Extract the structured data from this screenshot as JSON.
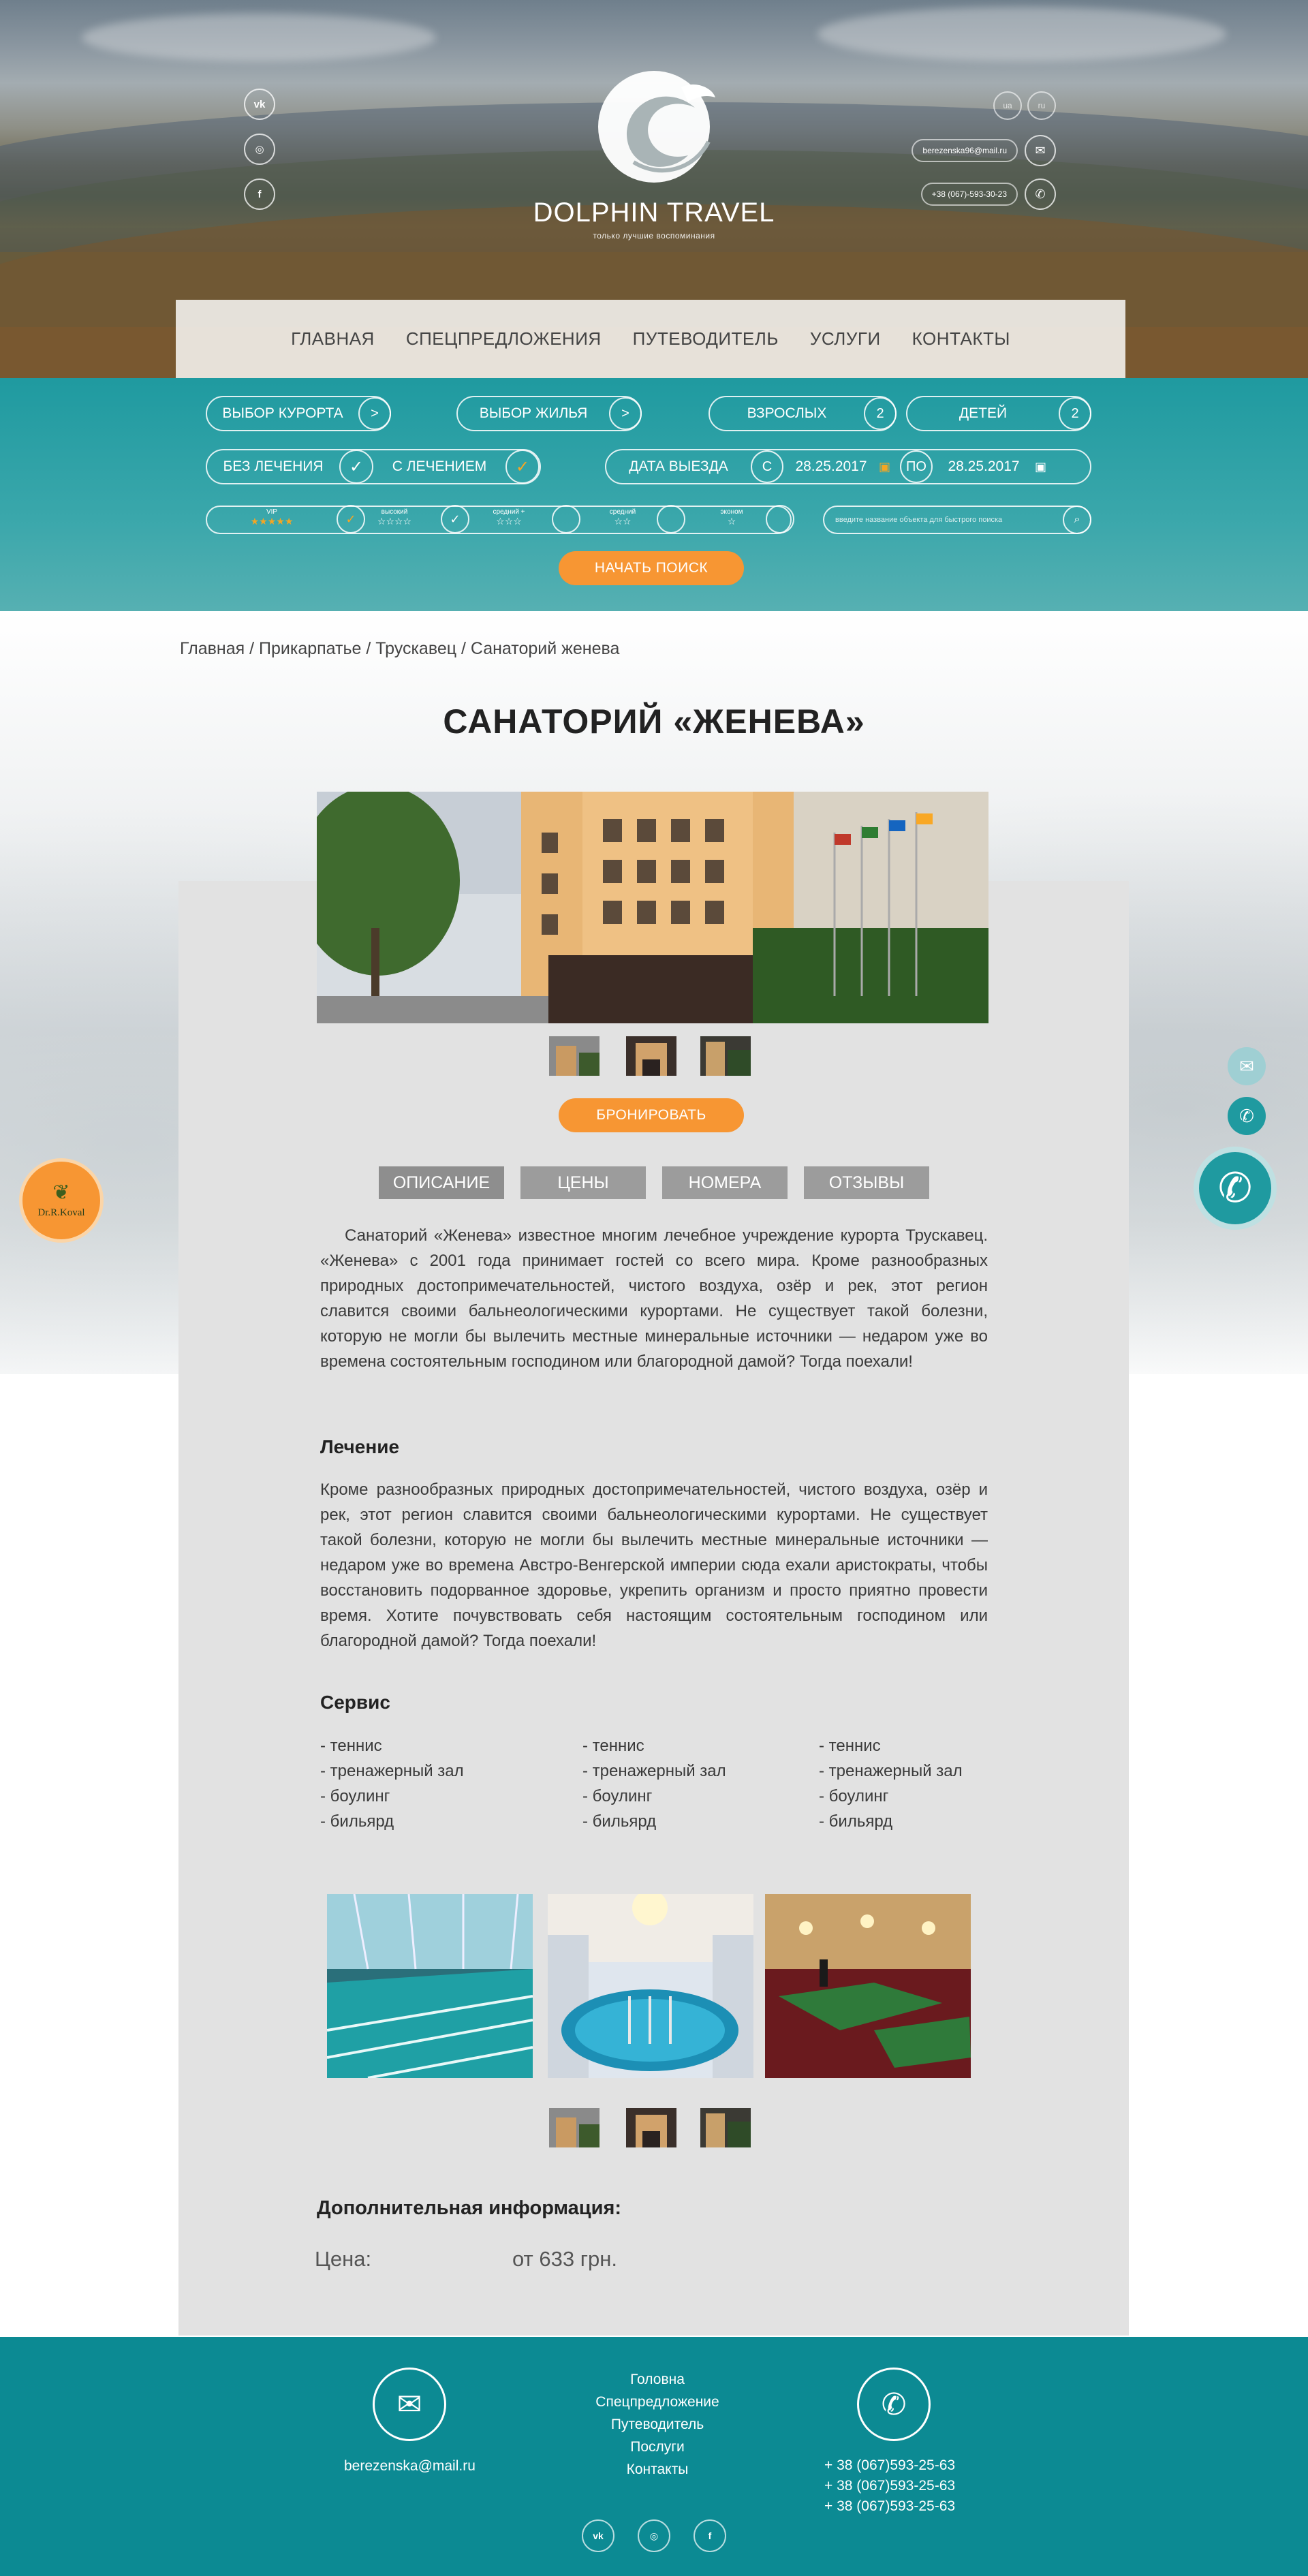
{
  "colors": {
    "teal": "#1f9aa0",
    "footer_teal": "#0c8a93",
    "orange": "#f79633",
    "card_gray": "#e2e2e2",
    "tab_gray": "#9c9c9c"
  },
  "header": {
    "social": [
      {
        "icon": "vk-icon",
        "glyph": "vk"
      },
      {
        "icon": "instagram-icon",
        "glyph": "◎"
      },
      {
        "icon": "facebook-icon",
        "glyph": "f"
      }
    ],
    "logo_name": "DOLPHIN TRAVEL",
    "logo_tagline": "только лучшие воспоминания",
    "lang": [
      "ua",
      "ru"
    ],
    "email": "berezenska96@mail.ru",
    "phone": "+38 (067)-593-30-23"
  },
  "nav": [
    "ГЛАВНАЯ",
    "СПЕЦПРЕДЛОЖЕНИЯ",
    "ПУТЕВОДИТЕЛЬ",
    "УСЛУГИ",
    "КОНТАКТЫ"
  ],
  "search": {
    "resort_label": "ВЫБОР КУРОРТА",
    "housing_label": "ВЫБОР ЖИЛЬЯ",
    "adults_label": "ВЗРОСЛЫХ",
    "adults_value": "2",
    "children_label": "ДЕТЕЙ",
    "children_value": "2",
    "no_treatment": "БЕЗ ЛЕЧЕНИЯ",
    "with_treatment": "С ЛЕЧЕНИЕМ",
    "departure_label": "ДАТА ВЫЕЗДА",
    "from_label": "С",
    "from_date": "28.25.2017",
    "to_label": "ПО",
    "to_date": "28.25.2017",
    "classes": [
      {
        "label": "VIP",
        "stars": "★★★★★",
        "gold": true
      },
      {
        "label": "высокий",
        "stars": "☆☆☆☆",
        "gold": false
      },
      {
        "label": "средний +",
        "stars": "☆☆☆",
        "gold": false
      },
      {
        "label": "средний",
        "stars": "☆☆",
        "gold": false
      },
      {
        "label": "эконом",
        "stars": "☆",
        "gold": false
      }
    ],
    "quick_placeholder": "введите название объекта для быстрого поиска",
    "submit": "НАЧАТЬ ПОИСК"
  },
  "breadcrumb": "Главная / Прикарпатье / Трускавец / Санаторий женева",
  "title": "САНАТОРИЙ «ЖЕНЕВА»",
  "book_button": "БРОНИРОВАТЬ",
  "tabs": [
    "ОПИСАНИЕ",
    "ЦЕНЫ",
    "НОМЕРА",
    "ОТЗЫВЫ"
  ],
  "description": "Санаторий «Женева» известное многим лечебное учреждение курорта Трускавец. «Женева» с 2001 года принимает гостей со всего мира. Кроме разнообразных природных достопримечательностей, чистого воздуха, озёр и рек, этот регион славится своими бальнеологическими курортами. Не существует такой болезни, которую не могли бы вылечить местные минеральные источники — недаром уже во времена состоятельным господином или благородной дамой? Тогда поехали!",
  "treatment": {
    "heading": "Лечение",
    "text": "Кроме разнообразных природных достопримечательностей, чистого воздуха, озёр и рек, этот регион славится своими бальнеологическими курортами. Не существует такой болезни, которую не могли бы вылечить местные минеральные источники — недаром уже во времена Австро-Венгерской империи сюда ехали аристократы, чтобы восстановить подорванное здоровье, укрепить организм и просто приятно провести время. Хотите почувствовать себя настоящим состоятельным господином или благородной дамой? Тогда поехали!"
  },
  "service": {
    "heading": "Сервис",
    "columns": [
      [
        "- теннис",
        "- тренажерный зал",
        "- боулинг",
        "- бильярд"
      ],
      [
        "- теннис",
        "- тренажерный зал",
        "- боулинг",
        "- бильярд"
      ],
      [
        "- теннис",
        "- тренажерный зал",
        "- боулинг",
        "- бильярд"
      ]
    ]
  },
  "extra": {
    "heading": "Дополнительная информация:",
    "price_label": "Цена:",
    "price_value": "от 633 грн."
  },
  "badge": "Dr.R.Koval",
  "footer": {
    "email": "berezenska@mail.ru",
    "nav": [
      "Головна",
      "Спецпредложение",
      "Путеводитель",
      "Послуги",
      "Контакты"
    ],
    "phones": [
      "+ 38 (067)593-25-63",
      "+ 38 (067)593-25-63",
      "+ 38 (067)593-25-63"
    ],
    "social": [
      {
        "icon": "vk-icon",
        "glyph": "vk"
      },
      {
        "icon": "instagram-icon",
        "glyph": "◎"
      },
      {
        "icon": "facebook-icon",
        "glyph": "f"
      }
    ]
  }
}
